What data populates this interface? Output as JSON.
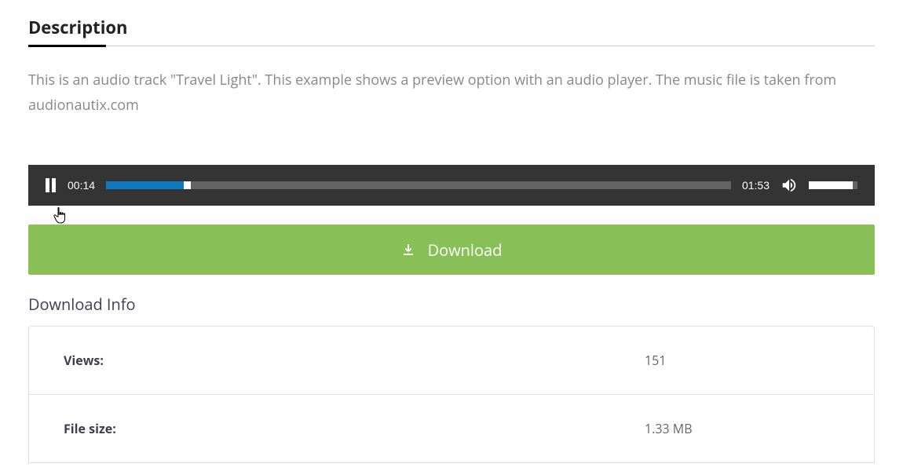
{
  "section": {
    "title": "Description"
  },
  "description": "This is an audio track \"Travel Light\". This example shows a preview option with an audio player. The music file is taken from audionautix.com",
  "player": {
    "current_time": "00:14",
    "duration": "01:53",
    "progress_percent": 12.4,
    "thumb_percent": 12.4,
    "volume_percent": 90
  },
  "download_button": {
    "label": "Download"
  },
  "info_section": {
    "title": "Download Info"
  },
  "info": [
    {
      "label": "Views:",
      "value": "151"
    },
    {
      "label": "File size:",
      "value": "1.33 MB"
    }
  ]
}
